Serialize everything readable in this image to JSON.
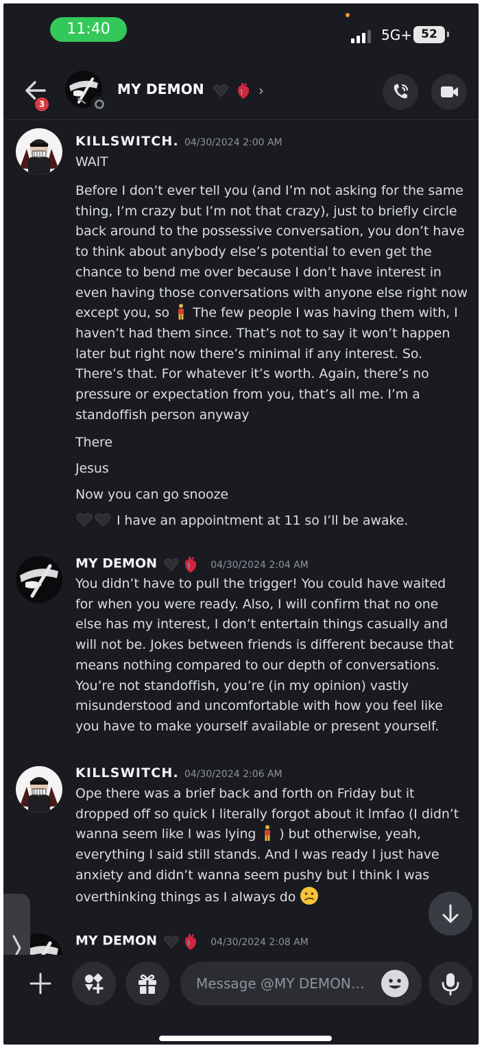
{
  "status_bar": {
    "time": "11:40",
    "network": "5G+",
    "battery": "52"
  },
  "header": {
    "title": "MY DEMON",
    "unread_badge": "3"
  },
  "colors": {
    "background": "#1a1b21",
    "green_pill": "#34c759",
    "badge_red": "#d83a42",
    "heart_red": "#c8203a"
  },
  "messages": [
    {
      "author": "KILLSWITCH.",
      "timestamp": "04/30/2024 2:00 AM",
      "lines": [
        "WAIT",
        "Before I don’t ever tell you (and I’m not asking for the same",
        "thing, I’m crazy but I’m not that crazy), just to briefly circle",
        "back around to the possessive conversation, you don’t have",
        "to think about anybody else’s potential to even get the",
        "chance to bend me over because I don’t have interest in",
        "even having those conversations with anyone else right now",
        "except you, so",
        "The few people I was having them with, I",
        "haven’t had them since. That’s not to say it won’t happen",
        "later but right now there’s minimal if any interest. So.",
        "There’s that. For whatever it’s worth. Again, there’s no",
        "pressure or expectation from you, that’s all me. I’m a",
        "standoffish person anyway",
        "There",
        "Jesus",
        "Now you can go snooze",
        "I have an appointment at 11 so I’ll be awake."
      ]
    },
    {
      "author": "MY DEMON",
      "timestamp": "04/30/2024 2:04 AM",
      "lines": [
        "You didn’t have to pull the trigger! You could have waited",
        "for when you were ready. Also, I will confirm that no one",
        "else has my interest, I don’t entertain things casually and",
        "will not be. Jokes between friends is different because that",
        "means nothing compared to our depth of conversations.",
        "You’re not standoffish, you’re (in my opinion) vastly",
        "misunderstood and uncomfortable with how you feel like",
        "you have to make yourself available or present yourself."
      ]
    },
    {
      "author": "KILLSWITCH.",
      "timestamp": "04/30/2024 2:06 AM",
      "lines": [
        "Ope there was a brief back and forth on Friday but it",
        "dropped off so quick I literally forgot about it lmfao (I didn’t",
        "wanna seem like I was lying",
        ") but otherwise, yeah,",
        "everything I said still stands. And I was ready I just have",
        "anxiety and didn’t wanna seem pushy but I think I was",
        "overthinking things as I always do"
      ]
    },
    {
      "author": "MY DEMON",
      "timestamp": "04/30/2024 2:08 AM",
      "lines": []
    }
  ],
  "composer": {
    "placeholder": "Message @MY DEMON…"
  },
  "icons": {
    "back": "arrow-left-icon",
    "call": "phone-call-icon",
    "video": "video-camera-icon",
    "add": "plus-icon",
    "apps": "apps-icon",
    "gift": "gift-icon",
    "emoji": "smile-icon",
    "mic": "microphone-icon",
    "scroll_down": "arrow-down-icon",
    "drawer": "chevron-right-icon"
  }
}
